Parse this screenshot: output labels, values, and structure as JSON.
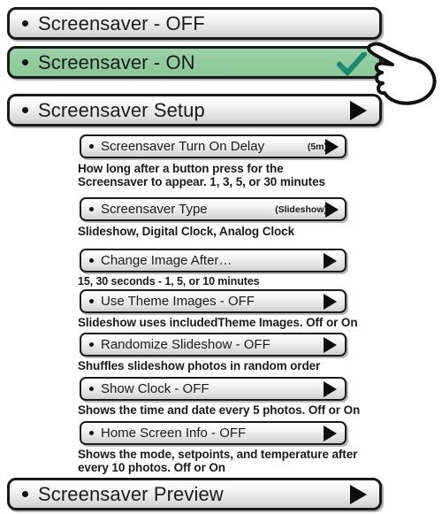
{
  "colors": {
    "selected_row_green": "#93cd9f",
    "checkmark_teal": "#1a8a72",
    "button_border": "#1a1a1a",
    "text": "#1b1b1b"
  },
  "main_rows": [
    {
      "label": "Screensaver - OFF",
      "state": "unselected",
      "has_arrow": false,
      "has_check": false
    },
    {
      "label": "Screensaver - ON",
      "state": "selected",
      "has_arrow": false,
      "has_check": true
    },
    {
      "label": "Screensaver Setup",
      "state": "unselected",
      "has_arrow": true,
      "has_check": false
    }
  ],
  "sub_rows": [
    {
      "label": "Screensaver Turn On Delay",
      "value": "(5m)",
      "description": "How long after a button press for the\nScreensaver to appear. 1, 3, 5, or 30 minutes",
      "desc_size": "normal"
    },
    {
      "label": "Screensaver Type",
      "value": "(Slideshow)",
      "description": "Slideshow, Digital Clock, Analog Clock",
      "desc_size": "normal"
    },
    {
      "label": "Change Image After…",
      "value": "",
      "description": "15, 30 seconds - 1, 5, or 10 minutes",
      "desc_size": "small"
    },
    {
      "label": "Use Theme Images - OFF",
      "value": "",
      "description": "Slideshow uses includedTheme Images. Off or On",
      "desc_size": "normal"
    },
    {
      "label": "Randomize Slideshow - OFF",
      "value": "",
      "description": "Shuffles slideshow photos in random order",
      "desc_size": "normal"
    },
    {
      "label": "Show Clock - OFF",
      "value": "",
      "description": "Shows the time and date every 5 photos. Off or On",
      "desc_size": "normal"
    },
    {
      "label": "Home Screen Info - OFF",
      "value": "",
      "description": "Shows the mode, setpoints, and temperature after\nevery 10 photos. Off or On",
      "desc_size": "normal"
    }
  ],
  "footer_row": {
    "label": "Screensaver Preview",
    "has_arrow": true
  },
  "icons": {
    "bullet": "bullet-dot-icon",
    "arrow": "play-triangle-icon",
    "check": "checkmark-icon",
    "cursor": "pointing-hand-cursor-icon"
  }
}
